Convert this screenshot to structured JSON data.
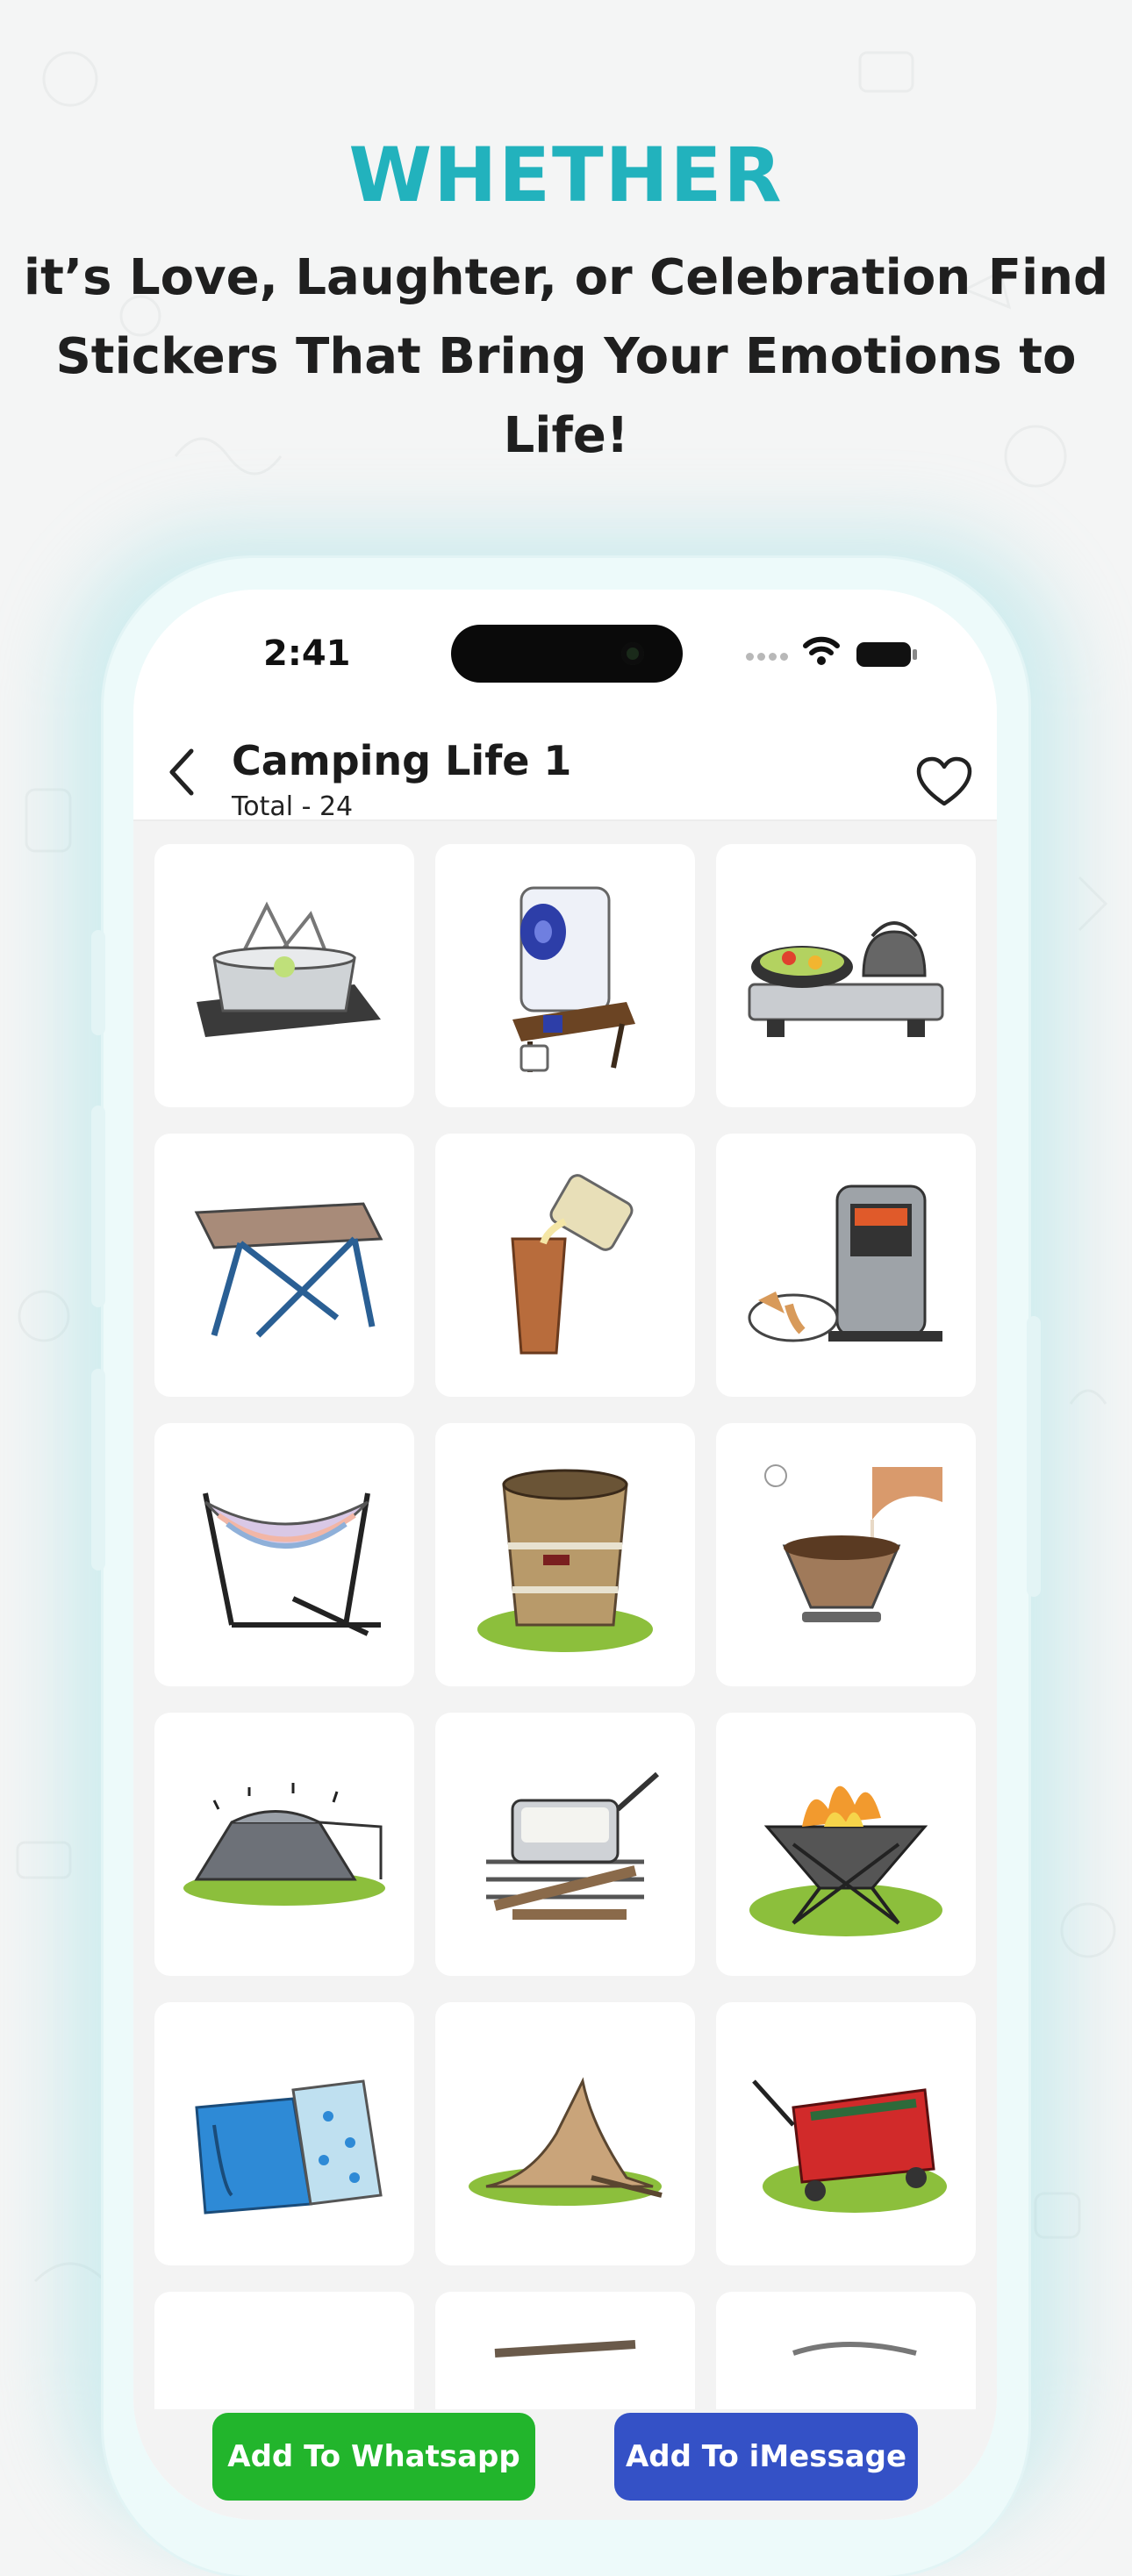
{
  "promo": {
    "headline": "WHETHER",
    "line1": "it’s Love, Laughter, or Celebration Find",
    "line2": "Stickers That Bring Your Emotions to Life!"
  },
  "status_bar": {
    "time": "2:41",
    "icons": [
      "signal-dots-icon",
      "wifi-icon",
      "battery-icon"
    ]
  },
  "nav": {
    "title": "Camping Life 1",
    "subtitle": "Total - 24",
    "back_icon": "chevron-left-icon",
    "favorite_icon": "heart-outline-icon"
  },
  "stickers": [
    "dish-basket",
    "water-jug",
    "camp-stove",
    "camp-table",
    "beer-pour",
    "kerosene-heater-with-dog",
    "hammock",
    "fire-bucket",
    "coffee-dripper",
    "tent",
    "mess-tin-on-fire",
    "fire-pit",
    "sleeping-bag",
    "ground-fire",
    "camp-wagon",
    "partial-sticker-16",
    "partial-sticker-17",
    "partial-sticker-18"
  ],
  "buttons": {
    "whatsapp": "Add To Whatsapp",
    "imessage": "Add To iMessage"
  },
  "colors": {
    "accent": "#22b2bd",
    "whatsapp": "#22b52c",
    "imessage": "#3451c6"
  }
}
